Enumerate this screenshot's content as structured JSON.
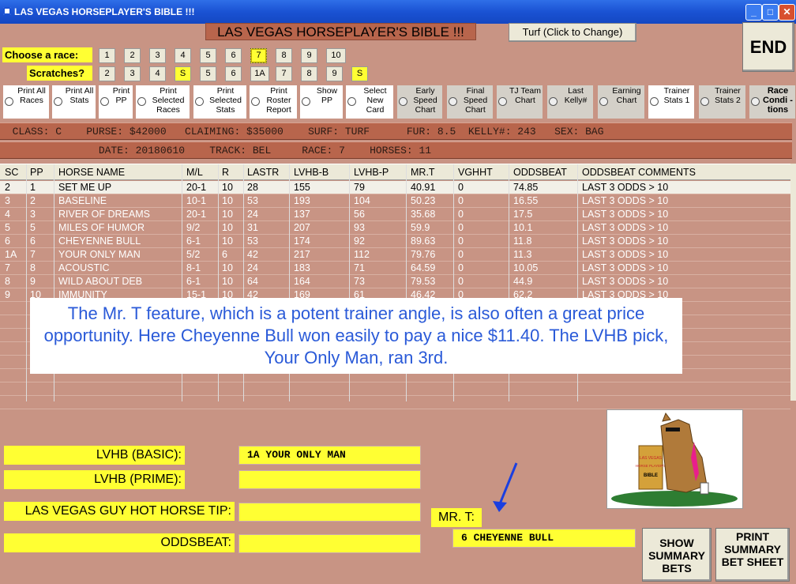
{
  "window": {
    "title": "LAS VEGAS HORSEPLAYER'S BIBLE !!!",
    "min": "_",
    "max": "□",
    "close": "✕"
  },
  "header": {
    "app_title": "LAS VEGAS HORSEPLAYER'S BIBLE !!!",
    "turf_button": "Turf (Click to Change)",
    "end_button": "END"
  },
  "race_select": {
    "label": "Choose  a race:",
    "buttons": [
      "1",
      "2",
      "3",
      "4",
      "5",
      "6",
      "7",
      "8",
      "9",
      "10"
    ],
    "selected": "7"
  },
  "scratches": {
    "label": "Scratches?",
    "buttons": [
      "2",
      "3",
      "4",
      "S",
      "5",
      "6",
      "1A",
      "7",
      "8",
      "9",
      "S"
    ]
  },
  "options": [
    {
      "label": "Print All Races",
      "style": "white"
    },
    {
      "label": "Print All Stats",
      "style": "white"
    },
    {
      "label": "Print PP",
      "style": "white"
    },
    {
      "label": "Print Selected Races",
      "style": "white"
    },
    {
      "label": "Print Selected Stats",
      "style": "white"
    },
    {
      "label": "Print Roster Report",
      "style": "white"
    },
    {
      "label": "Show PP",
      "style": "white"
    },
    {
      "label": "Select New Card",
      "style": "white"
    },
    {
      "label": "Early Speed Chart",
      "style": "gray"
    },
    {
      "label": "Final Speed Chart",
      "style": "gray"
    },
    {
      "label": "TJ Team Chart",
      "style": "gray"
    },
    {
      "label": "Last Kelly#",
      "style": "gray"
    },
    {
      "label": "Earning Chart",
      "style": "gray"
    },
    {
      "label": "Trainer Stats 1",
      "style": "white"
    },
    {
      "label": "Trainer Stats 2",
      "style": "gray"
    },
    {
      "label": "Race Condi -tions",
      "style": "gray"
    }
  ],
  "info": {
    "line1": "  CLASS: C    PURSE: $42000   CLAIMING: $35000    SURF: TURF      FUR: 8.5  KELLY#: 243   SEX: BAG",
    "line2": "                DATE: 20180610    TRACK: BEL     RACE: 7    HORSES: 11"
  },
  "table": {
    "columns": [
      "SC",
      "PP",
      "HORSE NAME",
      "M/L",
      "R",
      "LASTR",
      "LVHB-B",
      "LVHB-P",
      "MR.T",
      "VGHHT",
      "ODDSBEAT",
      "ODDSBEAT COMMENTS"
    ],
    "rows": [
      [
        "2",
        "1",
        "SET ME UP",
        "20-1",
        "10",
        "28",
        "155",
        "79",
        "40.91",
        "0",
        "74.85",
        "LAST 3 ODDS > 10"
      ],
      [
        "3",
        "2",
        "BASELINE",
        "10-1",
        "10",
        "53",
        "193",
        "104",
        "50.23",
        "0",
        "16.55",
        "LAST 3 ODDS > 10"
      ],
      [
        "4",
        "3",
        "RIVER OF DREAMS",
        "20-1",
        "10",
        "24",
        "137",
        "56",
        "35.68",
        "0",
        "17.5",
        "LAST 3 ODDS > 10"
      ],
      [
        "5",
        "5",
        "MILES OF HUMOR",
        "9/2",
        "10",
        "31",
        "207",
        "93",
        "59.9",
        "0",
        "10.1",
        "LAST 3 ODDS > 10"
      ],
      [
        "6",
        "6",
        "CHEYENNE BULL",
        "6-1",
        "10",
        "53",
        "174",
        "92",
        "89.63",
        "0",
        "11.8",
        "LAST 3 ODDS > 10"
      ],
      [
        "1A",
        "7",
        "YOUR ONLY MAN",
        "5/2",
        "6",
        "42",
        "217",
        "112",
        "79.76",
        "0",
        "11.3",
        "LAST 3 ODDS > 10"
      ],
      [
        "7",
        "8",
        "ACOUSTIC",
        "8-1",
        "10",
        "24",
        "183",
        "71",
        "64.59",
        "0",
        "10.05",
        "LAST 3 ODDS > 10"
      ],
      [
        "8",
        "9",
        "WILD ABOUT DEB",
        "6-1",
        "10",
        "64",
        "164",
        "73",
        "79.53",
        "0",
        "44.9",
        "LAST 3 ODDS > 10"
      ],
      [
        "9",
        "10",
        "IMMUNITY",
        "15-1",
        "10",
        "42",
        "169",
        "61",
        "46.42",
        "0",
        "62.2",
        "LAST 3 ODDS > 10"
      ]
    ]
  },
  "overlay_text": "The Mr. T feature, which is a potent trainer angle, is also often a great price opportunity.  Here Cheyenne Bull won easily to pay a nice $11.40.  The LVHB pick, Your Only Man, ran 3rd.",
  "fields": {
    "basic_label": "LVHB (BASIC):",
    "basic_value": "1A  YOUR ONLY MAN",
    "prime_label": "LVHB (PRIME):",
    "prime_value": "",
    "hot_label": "LAS VEGAS GUY HOT HORSE TIP:",
    "hot_value": "",
    "oddsbeat_label": "ODDSBEAT:",
    "oddsbeat_value": "",
    "mrt_label": "MR. T:",
    "mrt_value": "6   CHEYENNE BULL"
  },
  "buttons": {
    "show_summary": "SHOW SUMMARY BETS",
    "print_summary": "PRINT SUMMARY BET SHEET"
  },
  "logo": {
    "text_top": "LAS VEGAS",
    "text_mid": "HORSE PLAYER'S",
    "text_bot": "BIBLE"
  },
  "colors": {
    "accent_yellow": "#ffff33",
    "background": "#c89484",
    "bar": "#b8654c",
    "overlay_text": "#2a5ad8"
  }
}
